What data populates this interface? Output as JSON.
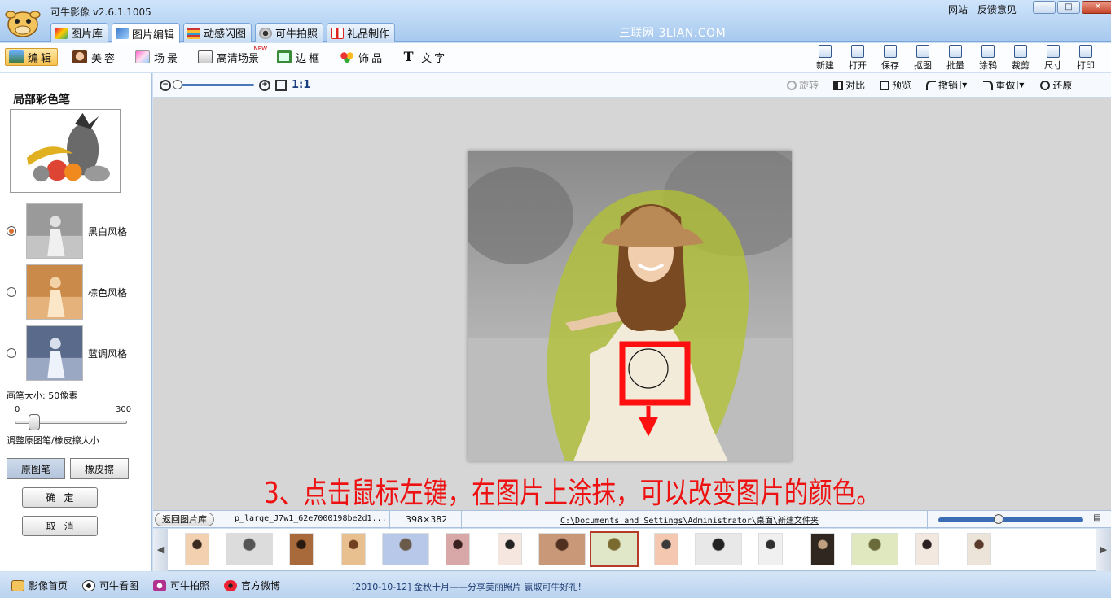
{
  "app": {
    "title": "可牛影像  v2.6.1.1005",
    "watermark": "三联网 3LIAN.COM",
    "top_links": [
      "网站",
      "反馈意见"
    ],
    "window_buttons": [
      "—",
      "□",
      "✕"
    ]
  },
  "main_tabs": [
    {
      "label": "图片库",
      "active": false,
      "icon": "gallery-icon"
    },
    {
      "label": "图片编辑",
      "active": true,
      "icon": "edit-icon"
    },
    {
      "label": "动感闪图",
      "active": false,
      "icon": "animation-icon"
    },
    {
      "label": "可牛拍照",
      "active": false,
      "icon": "camera-icon"
    },
    {
      "label": "礼品制作",
      "active": false,
      "icon": "gift-icon"
    }
  ],
  "sub_tabs": [
    {
      "label": "编辑",
      "active": true
    },
    {
      "label": "美容",
      "active": false
    },
    {
      "label": "场景",
      "active": false
    },
    {
      "label": "高清场景",
      "active": false,
      "badge": "NEW"
    },
    {
      "label": "边框",
      "active": false
    },
    {
      "label": "饰品",
      "active": false
    },
    {
      "label": "文字",
      "active": false
    }
  ],
  "tools": [
    "新建",
    "打开",
    "保存",
    "抠图",
    "批量",
    "涂鸦",
    "裁剪",
    "尺寸",
    "打印"
  ],
  "left_panel": {
    "title": "局部彩色笔",
    "styles": [
      {
        "label": "黑白风格",
        "selected": true
      },
      {
        "label": "棕色风格",
        "selected": false
      },
      {
        "label": "蓝调风格",
        "selected": false
      }
    ],
    "brush_size_label": "画笔大小: 50像素",
    "brush_min": "0",
    "brush_max": "300",
    "brush_value": 50,
    "brush_note": "调整原图笔/橡皮擦大小",
    "mode_buttons": [
      {
        "label": "原图笔",
        "active": true
      },
      {
        "label": "橡皮擦",
        "active": false
      }
    ],
    "confirm": "确定",
    "cancel": "取消"
  },
  "canvas_bar": {
    "zoom_label": "1:1",
    "actions": [
      {
        "label": "旋转",
        "disabled": true
      },
      {
        "label": "对比",
        "disabled": false
      },
      {
        "label": "预览",
        "disabled": false
      },
      {
        "label": "撤销",
        "disabled": false
      },
      {
        "label": "重做",
        "disabled": false
      },
      {
        "label": "还原",
        "disabled": false
      }
    ]
  },
  "canvas": {
    "instruction": "3、点击鼠标左键，在图片上涂抹，可以改变图片的颜色。"
  },
  "info_bar": {
    "back_button": "返回图片库",
    "file_name": "p_large_J7w1_62e7000198be2d1...",
    "image_size": "398×382",
    "folder_path": "C:\\Documents and Settings\\Administrator\\桌面\\新建文件夹"
  },
  "filmstrip": {
    "selected_index": 8,
    "count": 16
  },
  "status_bar": {
    "links": [
      "影像首页",
      "可牛看图",
      "可牛拍照",
      "官方微博"
    ],
    "news": "[2010-10-12] 金秋十月——分享美丽照片 赢取可牛好礼!"
  },
  "colors": {
    "accent": "#f6c14f",
    "instruction_text": "#ee1111",
    "highlight_box": "#ff1010",
    "titlebar": "#a7c9ee"
  }
}
